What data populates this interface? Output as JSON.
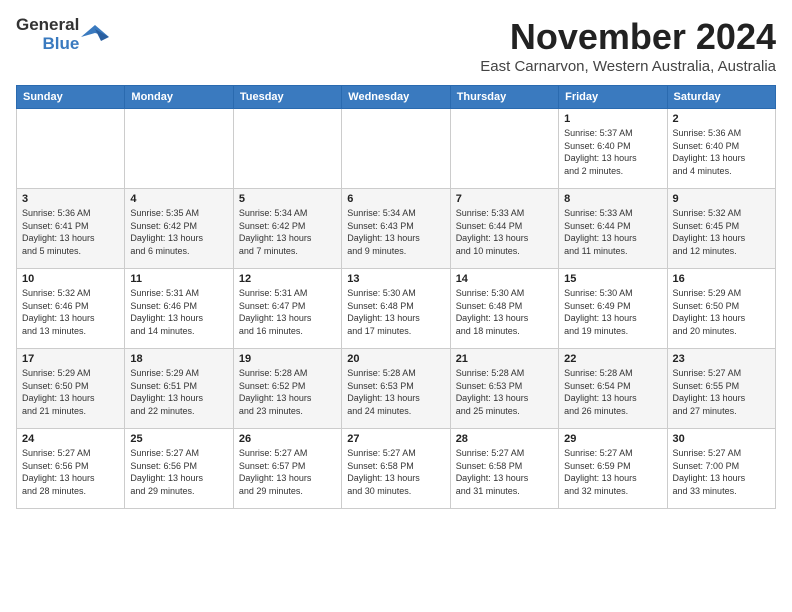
{
  "logo": {
    "line1": "General",
    "line2": "Blue"
  },
  "title": "November 2024",
  "subtitle": "East Carnarvon, Western Australia, Australia",
  "days_of_week": [
    "Sunday",
    "Monday",
    "Tuesday",
    "Wednesday",
    "Thursday",
    "Friday",
    "Saturday"
  ],
  "weeks": [
    [
      {
        "day": "",
        "info": ""
      },
      {
        "day": "",
        "info": ""
      },
      {
        "day": "",
        "info": ""
      },
      {
        "day": "",
        "info": ""
      },
      {
        "day": "",
        "info": ""
      },
      {
        "day": "1",
        "info": "Sunrise: 5:37 AM\nSunset: 6:40 PM\nDaylight: 13 hours\nand 2 minutes."
      },
      {
        "day": "2",
        "info": "Sunrise: 5:36 AM\nSunset: 6:40 PM\nDaylight: 13 hours\nand 4 minutes."
      }
    ],
    [
      {
        "day": "3",
        "info": "Sunrise: 5:36 AM\nSunset: 6:41 PM\nDaylight: 13 hours\nand 5 minutes."
      },
      {
        "day": "4",
        "info": "Sunrise: 5:35 AM\nSunset: 6:42 PM\nDaylight: 13 hours\nand 6 minutes."
      },
      {
        "day": "5",
        "info": "Sunrise: 5:34 AM\nSunset: 6:42 PM\nDaylight: 13 hours\nand 7 minutes."
      },
      {
        "day": "6",
        "info": "Sunrise: 5:34 AM\nSunset: 6:43 PM\nDaylight: 13 hours\nand 9 minutes."
      },
      {
        "day": "7",
        "info": "Sunrise: 5:33 AM\nSunset: 6:44 PM\nDaylight: 13 hours\nand 10 minutes."
      },
      {
        "day": "8",
        "info": "Sunrise: 5:33 AM\nSunset: 6:44 PM\nDaylight: 13 hours\nand 11 minutes."
      },
      {
        "day": "9",
        "info": "Sunrise: 5:32 AM\nSunset: 6:45 PM\nDaylight: 13 hours\nand 12 minutes."
      }
    ],
    [
      {
        "day": "10",
        "info": "Sunrise: 5:32 AM\nSunset: 6:46 PM\nDaylight: 13 hours\nand 13 minutes."
      },
      {
        "day": "11",
        "info": "Sunrise: 5:31 AM\nSunset: 6:46 PM\nDaylight: 13 hours\nand 14 minutes."
      },
      {
        "day": "12",
        "info": "Sunrise: 5:31 AM\nSunset: 6:47 PM\nDaylight: 13 hours\nand 16 minutes."
      },
      {
        "day": "13",
        "info": "Sunrise: 5:30 AM\nSunset: 6:48 PM\nDaylight: 13 hours\nand 17 minutes."
      },
      {
        "day": "14",
        "info": "Sunrise: 5:30 AM\nSunset: 6:48 PM\nDaylight: 13 hours\nand 18 minutes."
      },
      {
        "day": "15",
        "info": "Sunrise: 5:30 AM\nSunset: 6:49 PM\nDaylight: 13 hours\nand 19 minutes."
      },
      {
        "day": "16",
        "info": "Sunrise: 5:29 AM\nSunset: 6:50 PM\nDaylight: 13 hours\nand 20 minutes."
      }
    ],
    [
      {
        "day": "17",
        "info": "Sunrise: 5:29 AM\nSunset: 6:50 PM\nDaylight: 13 hours\nand 21 minutes."
      },
      {
        "day": "18",
        "info": "Sunrise: 5:29 AM\nSunset: 6:51 PM\nDaylight: 13 hours\nand 22 minutes."
      },
      {
        "day": "19",
        "info": "Sunrise: 5:28 AM\nSunset: 6:52 PM\nDaylight: 13 hours\nand 23 minutes."
      },
      {
        "day": "20",
        "info": "Sunrise: 5:28 AM\nSunset: 6:53 PM\nDaylight: 13 hours\nand 24 minutes."
      },
      {
        "day": "21",
        "info": "Sunrise: 5:28 AM\nSunset: 6:53 PM\nDaylight: 13 hours\nand 25 minutes."
      },
      {
        "day": "22",
        "info": "Sunrise: 5:28 AM\nSunset: 6:54 PM\nDaylight: 13 hours\nand 26 minutes."
      },
      {
        "day": "23",
        "info": "Sunrise: 5:27 AM\nSunset: 6:55 PM\nDaylight: 13 hours\nand 27 minutes."
      }
    ],
    [
      {
        "day": "24",
        "info": "Sunrise: 5:27 AM\nSunset: 6:56 PM\nDaylight: 13 hours\nand 28 minutes."
      },
      {
        "day": "25",
        "info": "Sunrise: 5:27 AM\nSunset: 6:56 PM\nDaylight: 13 hours\nand 29 minutes."
      },
      {
        "day": "26",
        "info": "Sunrise: 5:27 AM\nSunset: 6:57 PM\nDaylight: 13 hours\nand 29 minutes."
      },
      {
        "day": "27",
        "info": "Sunrise: 5:27 AM\nSunset: 6:58 PM\nDaylight: 13 hours\nand 30 minutes."
      },
      {
        "day": "28",
        "info": "Sunrise: 5:27 AM\nSunset: 6:58 PM\nDaylight: 13 hours\nand 31 minutes."
      },
      {
        "day": "29",
        "info": "Sunrise: 5:27 AM\nSunset: 6:59 PM\nDaylight: 13 hours\nand 32 minutes."
      },
      {
        "day": "30",
        "info": "Sunrise: 5:27 AM\nSunset: 7:00 PM\nDaylight: 13 hours\nand 33 minutes."
      }
    ]
  ]
}
